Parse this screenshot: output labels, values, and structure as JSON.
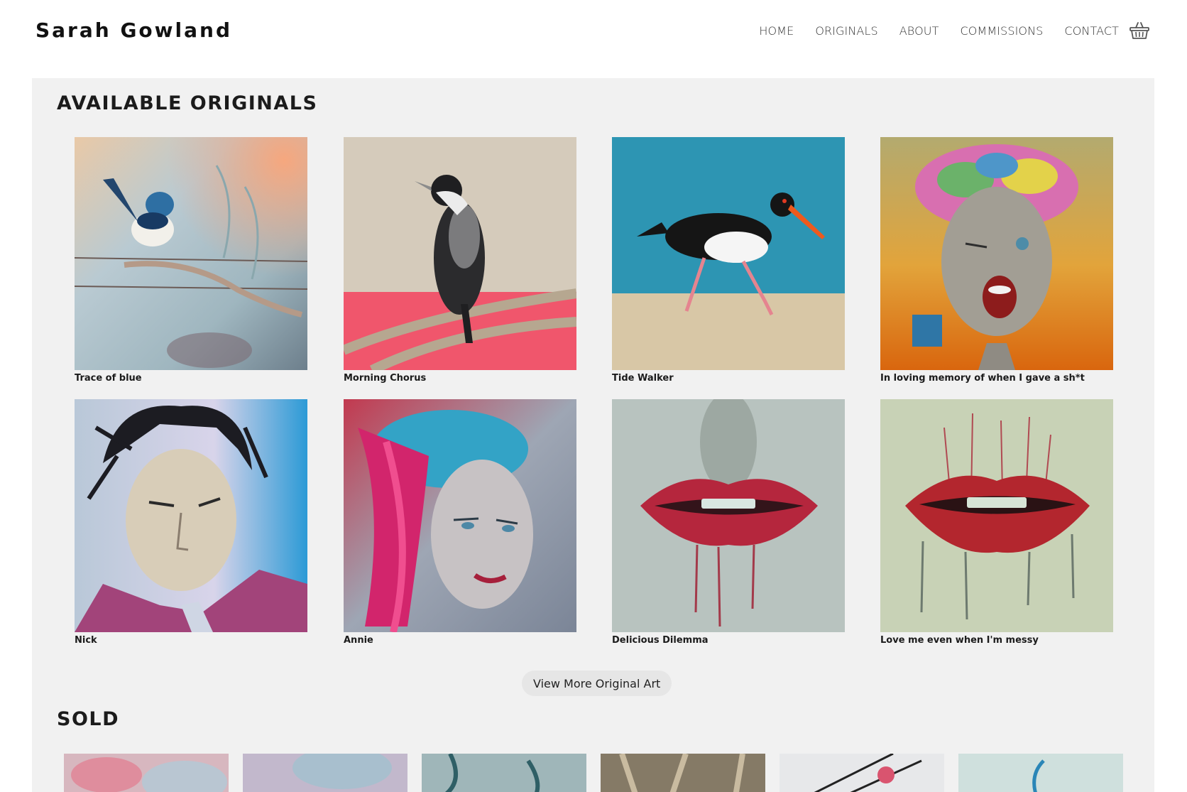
{
  "header": {
    "brand": "Sarah Gowland",
    "nav": [
      {
        "label": "HOME"
      },
      {
        "label": "ORIGINALS"
      },
      {
        "label": "ABOUT"
      },
      {
        "label": "COMMISSIONS"
      },
      {
        "label": "CONTACT"
      }
    ],
    "cart_icon": "basket-icon"
  },
  "available": {
    "title": "AVAILABLE ORIGINALS",
    "items": [
      {
        "title": "Trace of blue"
      },
      {
        "title": "Morning Chorus"
      },
      {
        "title": "Tide Walker"
      },
      {
        "title": "In loving memory of when I gave a sh*t"
      },
      {
        "title": "Nick"
      },
      {
        "title": "Annie"
      },
      {
        "title": "Delicious Dilemma"
      },
      {
        "title": "Love me even when I'm messy"
      }
    ],
    "more_button": "View More Original Art"
  },
  "sold": {
    "title": "SOLD"
  },
  "colors": {
    "panel_bg": "#f1f1f1",
    "button_bg": "#e6e6e6",
    "text": "#1d1d1d"
  }
}
